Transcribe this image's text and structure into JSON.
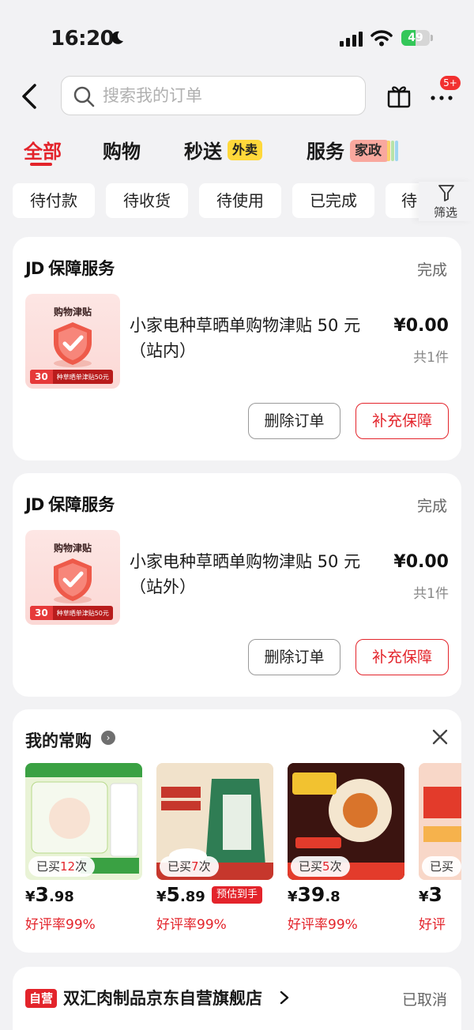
{
  "status_bar": {
    "time": "16:20",
    "battery": "49",
    "battery_level": 0.49
  },
  "header": {
    "search_placeholder": "搜索我的订单",
    "more_badge": "5+"
  },
  "tabs": [
    {
      "label": "全部"
    },
    {
      "label": "购物"
    },
    {
      "label": "秒送",
      "tag": "外卖"
    },
    {
      "label": "服务",
      "tag": "家政"
    }
  ],
  "filter_chips": [
    "待付款",
    "待收货",
    "待使用",
    "已完成",
    "待"
  ],
  "filter_label": "筛选",
  "orders": [
    {
      "brand": "JD",
      "shop": "保障服务",
      "status": "完成",
      "thumb_title": "购物津贴",
      "thumb_num": "30",
      "thumb_text": "种草晒单津贴50元",
      "name": "小家电种草晒单购物津贴 50 元（站内）",
      "price": "¥0.00",
      "count": "共1件",
      "btn_delete": "删除订单",
      "btn_action": "补充保障"
    },
    {
      "brand": "JD",
      "shop": "保障服务",
      "status": "完成",
      "thumb_title": "购物津贴",
      "thumb_num": "30",
      "thumb_text": "种草晒单津贴50元",
      "name": "小家电种草晒单购物津贴 50 元（站外）",
      "price": "¥0.00",
      "count": "共1件",
      "btn_delete": "删除订单",
      "btn_action": "补充保障"
    }
  ],
  "frequent": {
    "title": "我的常购",
    "items": [
      {
        "bought_prefix": "已买",
        "bought_num": "12",
        "bought_suffix": "次",
        "yen": "¥",
        "price_int": "3",
        "price_dec": ".98",
        "rate": "好评率99%",
        "color": "#e9f3d6"
      },
      {
        "bought_prefix": "已买",
        "bought_num": "7",
        "bought_suffix": "次",
        "yen": "¥",
        "price_int": "5",
        "price_dec": ".89",
        "pre": "预估到手",
        "rate": "好评率99%",
        "color": "#f6ead8"
      },
      {
        "bought_prefix": "已买",
        "bought_num": "5",
        "bought_suffix": "次",
        "yen": "¥",
        "price_int": "39",
        "price_dec": ".8",
        "rate": "好评率99%",
        "color": "#3b1410"
      },
      {
        "bought_prefix": "已买",
        "bought_num": "",
        "bought_suffix": "",
        "yen": "¥",
        "price_int": "3",
        "price_dec": "",
        "rate": "好评",
        "color": "#f8d7c8"
      }
    ]
  },
  "store_order": {
    "badge": "自营",
    "name": "双汇肉制品京东自营旗舰店",
    "status": "已取消"
  }
}
